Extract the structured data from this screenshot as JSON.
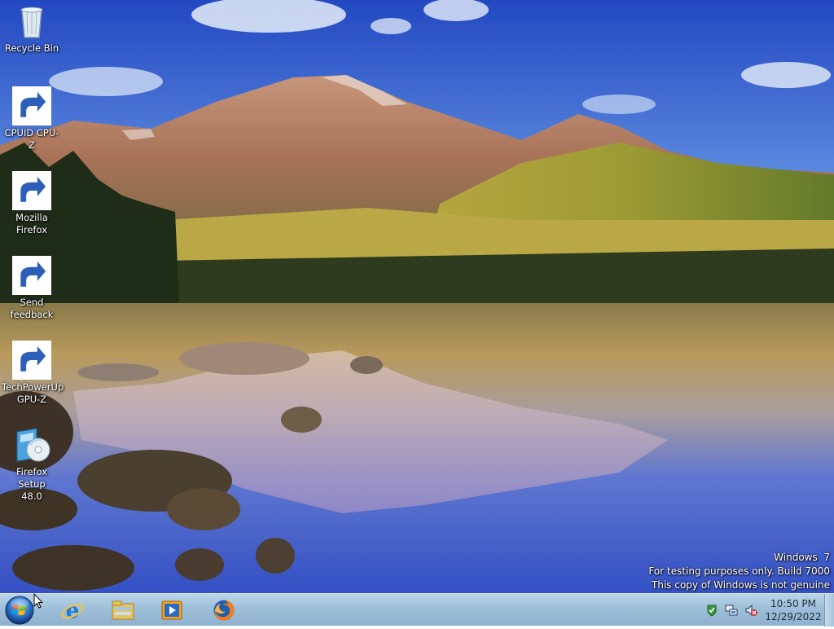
{
  "desktop": {
    "icons": [
      {
        "label": "Recycle Bin",
        "icon": "recycle-bin-icon"
      },
      {
        "label": "CPUID CPU-Z",
        "icon": "cpu-z-icon"
      },
      {
        "label": "Mozilla\nFirefox",
        "icon": "firefox-icon"
      },
      {
        "label": "Send\nfeedback",
        "icon": "send-feedback-icon"
      },
      {
        "label": "TechPowerUp\nGPU-Z",
        "icon": "gpu-z-icon"
      },
      {
        "label": "Firefox Setup\n48.0",
        "icon": "firefox-setup-icon"
      }
    ],
    "watermark": {
      "line1": "Windows  7",
      "line2": "For testing purposes only. Build 7000",
      "line3": "This copy of Windows is not genuine"
    }
  },
  "taskbar": {
    "start": {
      "icon": "windows-start-icon"
    },
    "pinned": [
      {
        "icon": "internet-explorer-icon"
      },
      {
        "icon": "windows-explorer-icon"
      },
      {
        "icon": "media-player-icon"
      },
      {
        "icon": "firefox-icon"
      }
    ],
    "tray": {
      "icons": [
        "action-center-icon",
        "network-icon",
        "volume-muted-icon"
      ],
      "time": "10:50 PM",
      "date": "12/29/2022"
    }
  },
  "colors": {
    "taskbar": "#9ebfd9",
    "sky": "#3a62c8",
    "water": "#2f4fc0"
  }
}
